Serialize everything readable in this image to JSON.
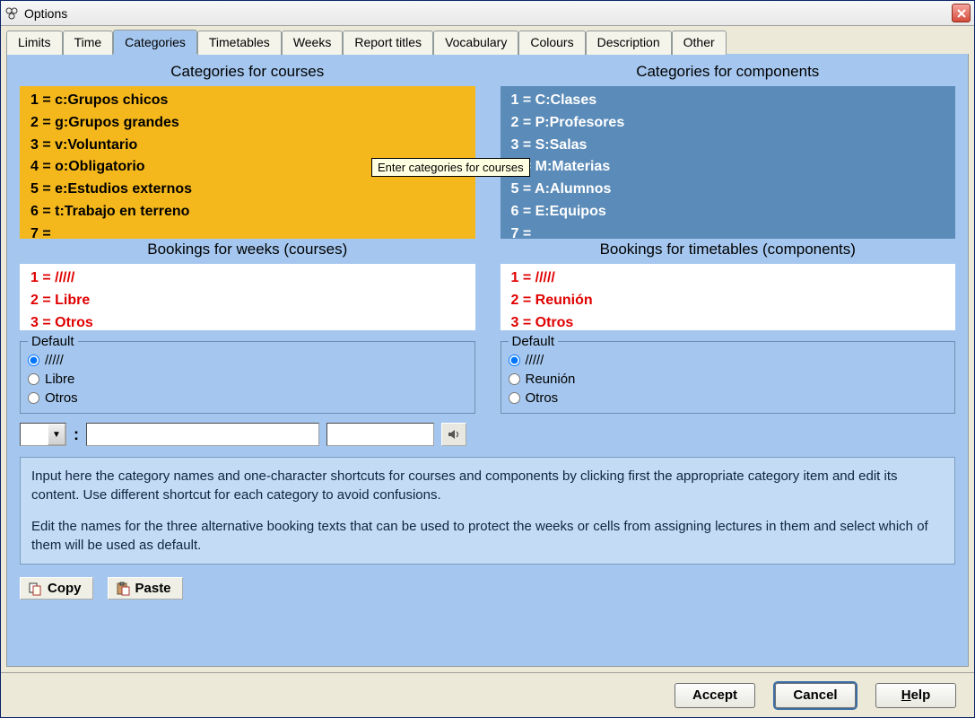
{
  "window": {
    "title": "Options"
  },
  "tabs": {
    "items": [
      "Limits",
      "Time",
      "Categories",
      "Timetables",
      "Weeks",
      "Report titles",
      "Vocabulary",
      "Colours",
      "Description",
      "Other"
    ],
    "active": "Categories"
  },
  "sections": {
    "courses_title": "Categories for courses",
    "components_title": "Categories for components",
    "bookings_courses_title": "Bookings for weeks (courses)",
    "bookings_components_title": "Bookings for timetables (components)"
  },
  "courses_categories": [
    "1 = c:Grupos chicos",
    "2 = g:Grupos grandes",
    "3 = v:Voluntario",
    "4 = o:Obligatorio",
    "5 = e:Estudios externos",
    "6 = t:Trabajo en terreno",
    "7 ="
  ],
  "components_categories": [
    "1 = C:Clases",
    "2 = P:Profesores",
    "3 = S:Salas",
    "4 = M:Materias",
    "5 = A:Alumnos",
    "6 = E:Equipos",
    "7 ="
  ],
  "bookings_courses": [
    "1 = /////",
    "2 = Libre",
    "3 = Otros"
  ],
  "bookings_components": [
    "1 = /////",
    "2 = Reunión",
    "3 = Otros"
  ],
  "default_label": "Default",
  "default_courses": {
    "options": [
      "/////",
      "Libre",
      "Otros"
    ],
    "selected": 0
  },
  "default_components": {
    "options": [
      "/////",
      "Reunión",
      "Otros"
    ],
    "selected": 0
  },
  "tooltip": "Enter categories for courses",
  "input_row": {
    "separator": ":",
    "combo_value": "",
    "name_value": "",
    "shortcut_value": ""
  },
  "help": {
    "p1": "Input here the category names and one-character shortcuts for courses and components by clicking first the appropriate category item and edit its content. Use different shortcut for each category to avoid confusions.",
    "p2": "Edit the names for the three alternative booking texts that can be used to protect the weeks or cells from assigning lectures in them and select which of them will be used as default."
  },
  "buttons": {
    "copy": "Copy",
    "paste": "Paste",
    "accept": "Accept",
    "cancel": "Cancel",
    "help": "Help"
  }
}
